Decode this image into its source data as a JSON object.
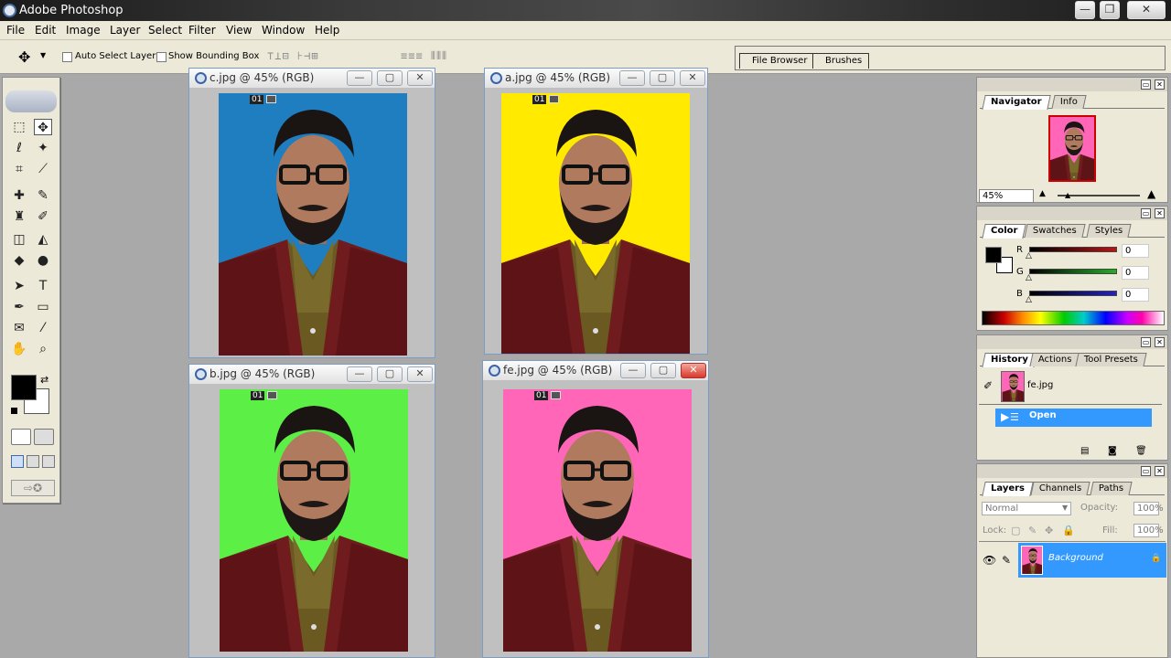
{
  "app": {
    "title": "Adobe Photoshop"
  },
  "window_controls": {
    "minimize": "—",
    "restore": "❐",
    "close": "✕"
  },
  "menu": [
    "File",
    "Edit",
    "Image",
    "Layer",
    "Select",
    "Filter",
    "View",
    "Window",
    "Help"
  ],
  "options": {
    "tool_glyph": "✥",
    "auto_select_label": "Auto Select Layer",
    "auto_select_checked": false,
    "bounding_box_label": "Show Bounding Box",
    "bounding_box_checked": false,
    "align_glyphs_a": "⊤⊥⊟ ⊦⊣⊞",
    "align_glyphs_b": "≡≡≡ ⫴⫴⫴"
  },
  "palette_well": {
    "tabs": [
      "File Browser",
      "Brushes"
    ]
  },
  "toolbox": {
    "tools": [
      {
        "name": "marquee-tool",
        "glyph": "⬚"
      },
      {
        "name": "move-tool",
        "glyph": "✥"
      },
      {
        "name": "lasso-tool",
        "glyph": "ℓ"
      },
      {
        "name": "magic-wand-tool",
        "glyph": "✦"
      },
      {
        "name": "crop-tool",
        "glyph": "⌗"
      },
      {
        "name": "slice-tool",
        "glyph": "⟋"
      },
      {
        "name": "healing-brush-tool",
        "glyph": "✚"
      },
      {
        "name": "brush-tool",
        "glyph": "✎"
      },
      {
        "name": "clone-stamp-tool",
        "glyph": "♜"
      },
      {
        "name": "history-brush-tool",
        "glyph": "✐"
      },
      {
        "name": "eraser-tool",
        "glyph": "◫"
      },
      {
        "name": "paint-bucket-tool",
        "glyph": "◭"
      },
      {
        "name": "blur-tool",
        "glyph": "◆"
      },
      {
        "name": "dodge-tool",
        "glyph": "●"
      },
      {
        "name": "path-selection-tool",
        "glyph": "➤"
      },
      {
        "name": "type-tool",
        "glyph": "T"
      },
      {
        "name": "pen-tool",
        "glyph": "✒"
      },
      {
        "name": "shape-tool",
        "glyph": "▭"
      },
      {
        "name": "notes-tool",
        "glyph": "✉"
      },
      {
        "name": "eyedropper-tool",
        "glyph": "⁄"
      },
      {
        "name": "hand-tool",
        "glyph": "✋"
      },
      {
        "name": "zoom-tool",
        "glyph": "⌕"
      }
    ],
    "swap_glyph": "⇄"
  },
  "documents": [
    {
      "id": "c",
      "title": "c.jpg @ 45% (RGB)",
      "background": "#1f7ec0",
      "badge": "01"
    },
    {
      "id": "a",
      "title": "a.jpg @ 45% (RGB)",
      "background": "#ffea00",
      "badge": "01"
    },
    {
      "id": "b",
      "title": "b.jpg @ 45% (RGB)",
      "background": "#5cf046",
      "badge": "01"
    },
    {
      "id": "fe",
      "title": "fe.jpg @ 45% (RGB)",
      "background": "#ff66b8",
      "badge": "01"
    }
  ],
  "navigator": {
    "tabs": [
      "Navigator",
      "Info"
    ],
    "zoom": "45%"
  },
  "color": {
    "tabs": [
      "Color",
      "Swatches",
      "Styles"
    ],
    "channels": [
      {
        "label": "R",
        "value": "0",
        "color": "#c41010"
      },
      {
        "label": "G",
        "value": "0",
        "color": "#22b022"
      },
      {
        "label": "B",
        "value": "0",
        "color": "#2222c8"
      }
    ]
  },
  "history": {
    "tabs": [
      "History",
      "Actions",
      "Tool Presets"
    ],
    "snapshot": "fe.jpg",
    "states": [
      "Open"
    ]
  },
  "layers": {
    "tabs": [
      "Layers",
      "Channels",
      "Paths"
    ],
    "blend_mode": "Normal",
    "opacity_label": "Opacity:",
    "opacity": "100%",
    "lock_label": "Lock:",
    "fill_label": "Fill:",
    "fill": "100%",
    "layer_name": "Background"
  },
  "colors": {
    "accent": "#3399ff",
    "panel": "#ece9d8",
    "workspace": "#a9a9a9"
  }
}
